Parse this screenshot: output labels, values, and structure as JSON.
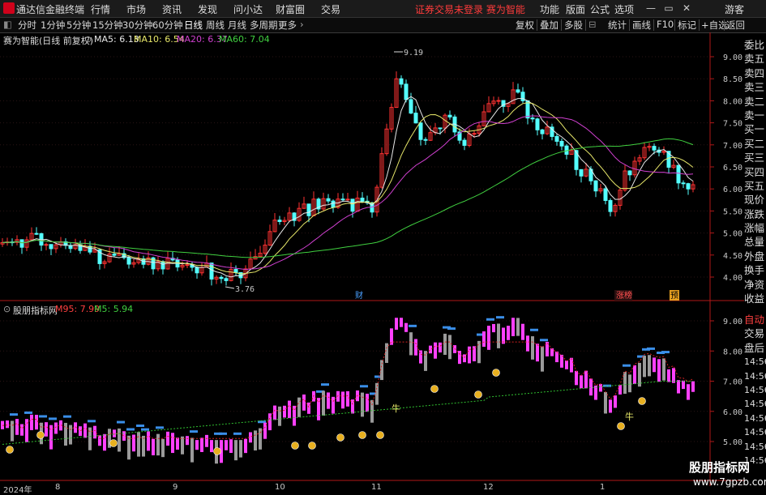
{
  "titlebar": {
    "app_name": "通达信金融终端",
    "menus": [
      "行情",
      "市场",
      "资讯",
      "发现",
      "问小达",
      "财富圈",
      "交易"
    ],
    "notice": "证券交易未登录  赛为智能",
    "right_menus": [
      "功能",
      "版面",
      "公式",
      "选项"
    ],
    "user": "游客"
  },
  "toolbar": {
    "periods": [
      "分时",
      "1分钟",
      "5分钟",
      "15分钟",
      "30分钟",
      "60分钟",
      "日线",
      "周线",
      "月线",
      "多周期",
      "更多"
    ],
    "active": "日线",
    "right_items": [
      "复权",
      "叠加",
      "多股",
      "统计",
      "画线",
      "F10",
      "标记",
      "+自选",
      "返回"
    ]
  },
  "main_chart": {
    "stock_label": "赛为智能(日线 前复权)",
    "ma": [
      {
        "label": "MA5: 6.13",
        "color": "#e8e8e8"
      },
      {
        "label": "MA10: 6.54",
        "color": "#e8e86a"
      },
      {
        "label": "MA20: 6.37",
        "color": "#d040d0"
      },
      {
        "label": "MA60: 7.04",
        "color": "#40d040"
      }
    ],
    "y_ticks": [
      "9.00",
      "8.50",
      "8.00",
      "7.50",
      "7.00",
      "6.50",
      "6.00",
      "5.50",
      "5.00",
      "4.50",
      "4.00"
    ],
    "high_label": "9.19",
    "low_label": "3.76",
    "event_tags": [
      "财",
      "涨榜",
      "预"
    ]
  },
  "sub_chart": {
    "name": "股朋指标网",
    "m95": "M95: 7.99",
    "m5": "M5: 5.94",
    "y_ticks": [
      "9.00",
      "8.00",
      "7.00",
      "6.00",
      "5.00"
    ],
    "marker_niu": "牛"
  },
  "side_panel": {
    "items_top": [
      "委比",
      "卖五",
      "卖四",
      "卖三",
      "卖二",
      "卖一",
      "买一",
      "买二",
      "买三",
      "买四",
      "买五",
      "现价",
      "涨跌",
      "涨幅",
      "总量",
      "外盘",
      "换手",
      "净资",
      "收益"
    ],
    "items_bottom": [
      "自动",
      "交易",
      "盘后",
      "14:56",
      "14:56",
      "14:56",
      "14:56",
      "14:56",
      "14:56",
      "14:56",
      "14:56",
      "14:56"
    ]
  },
  "x_axis": {
    "labels": [
      "2024年",
      "8",
      "9",
      "10",
      "11",
      "12",
      "1"
    ]
  },
  "watermark": {
    "line1": "股朋指标网",
    "line2": "www.7gpzb.com"
  },
  "colors": {
    "up": "#ff3232",
    "down": "#54ffff",
    "ma5": "#e8e8e8",
    "ma10": "#e8e86a",
    "ma20": "#d040d0",
    "ma60": "#40d040",
    "magenta": "#ff40ff",
    "blue": "#3a8ee8"
  }
}
